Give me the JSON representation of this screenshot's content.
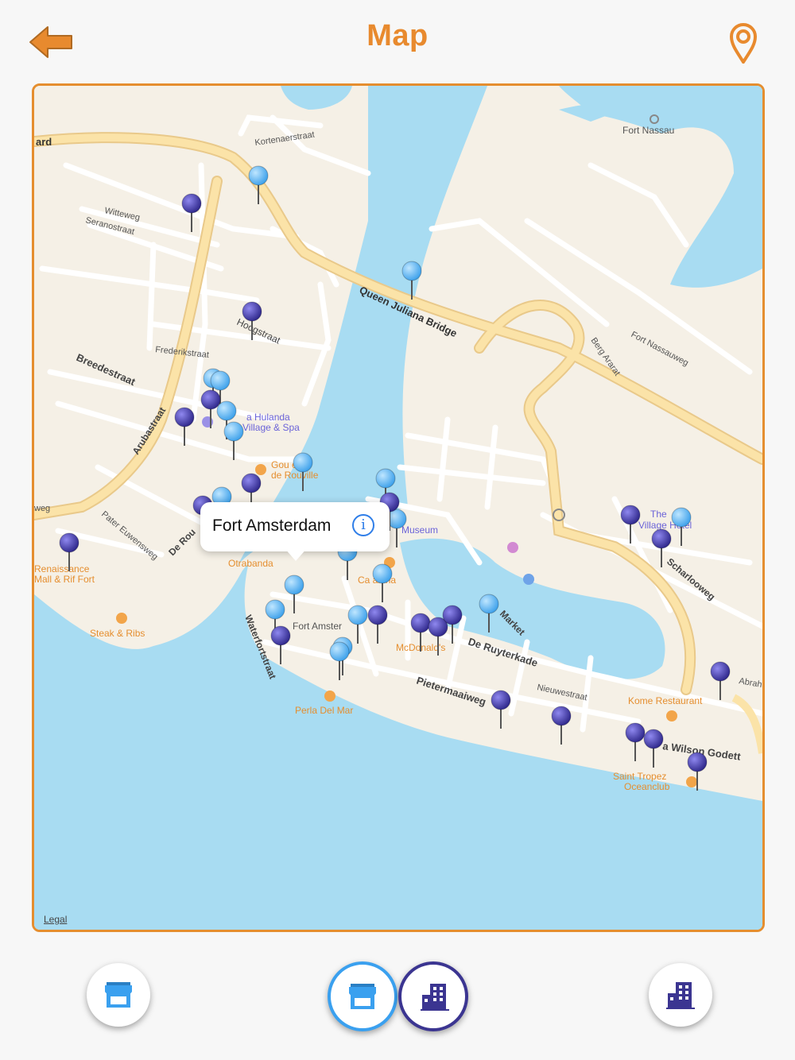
{
  "header": {
    "title": "Map"
  },
  "map": {
    "callout": {
      "title": "Fort Amsterdam"
    },
    "legal_label": "Legal",
    "labels": {
      "fort_nassau": "Fort Nassau",
      "kortenaerstraat": "Kortenaerstraat",
      "ard": "ard",
      "witteweg": "Witteweg",
      "seranostraat": "Seranostraat",
      "queen_juliana_bridge": "Queen Juliana Bridge",
      "hoogstraat": "Hoogstraat",
      "frederikstraat": "Frederikstraat",
      "breedestraat": "Breedestraat",
      "arubastraat": "Arubastraat",
      "berg_ararat": "Berg Ararat",
      "fort_nassauweg": "Fort Nassauweg",
      "hulanda_1": "a Hulanda",
      "hulanda_2": "Village & Spa",
      "gourmet_1": "Gou   eur",
      "gourmet_2": "de Rouville",
      "weg": "weg",
      "pater_euwensweg": "Pater Euwensweg",
      "de_rou": "De Rou",
      "museum": "Museum",
      "village_1": "The",
      "village_2": "Village Hotel",
      "renaissance_1": "Renaissance",
      "renaissance_2": "Mall & Rif Fort",
      "otrabanda": "Otrabanda",
      "ca_anina": "Ca    anina",
      "scharlooweg": "Scharlooweg",
      "fort_amster": "Fort Amster",
      "waterfortstraat": "Waterfortstraat",
      "mcdonalds": "McDonald's",
      "market": "Market",
      "de_ruyterkade": "De Ruyterkade",
      "steak_ribs": "Steak & Ribs",
      "nieuwestraat": "Nieuwestraat",
      "pietermaaiweg": "Pietermaaiweg",
      "perla_del_mar": "Perla Del Mar",
      "kome_restaurant": "Kome Restaurant",
      "abrah": "Abrah",
      "wilson_godett": "a Wilson Godett",
      "saint_tropez_1": "Saint Tropez",
      "saint_tropez_2": "Oceanclub"
    }
  },
  "icons": {
    "back": "arrow-left-icon",
    "location": "location-pin-icon",
    "shop": "storefront-icon",
    "hotel": "hotel-building-icon"
  },
  "colors": {
    "accent": "#e88a2e",
    "shop_pin": "#4aaef0",
    "hotel_pin": "#3b3591",
    "water": "#a8dcf2",
    "land": "#f5f0e6",
    "road_major": "#fbe3a8"
  }
}
